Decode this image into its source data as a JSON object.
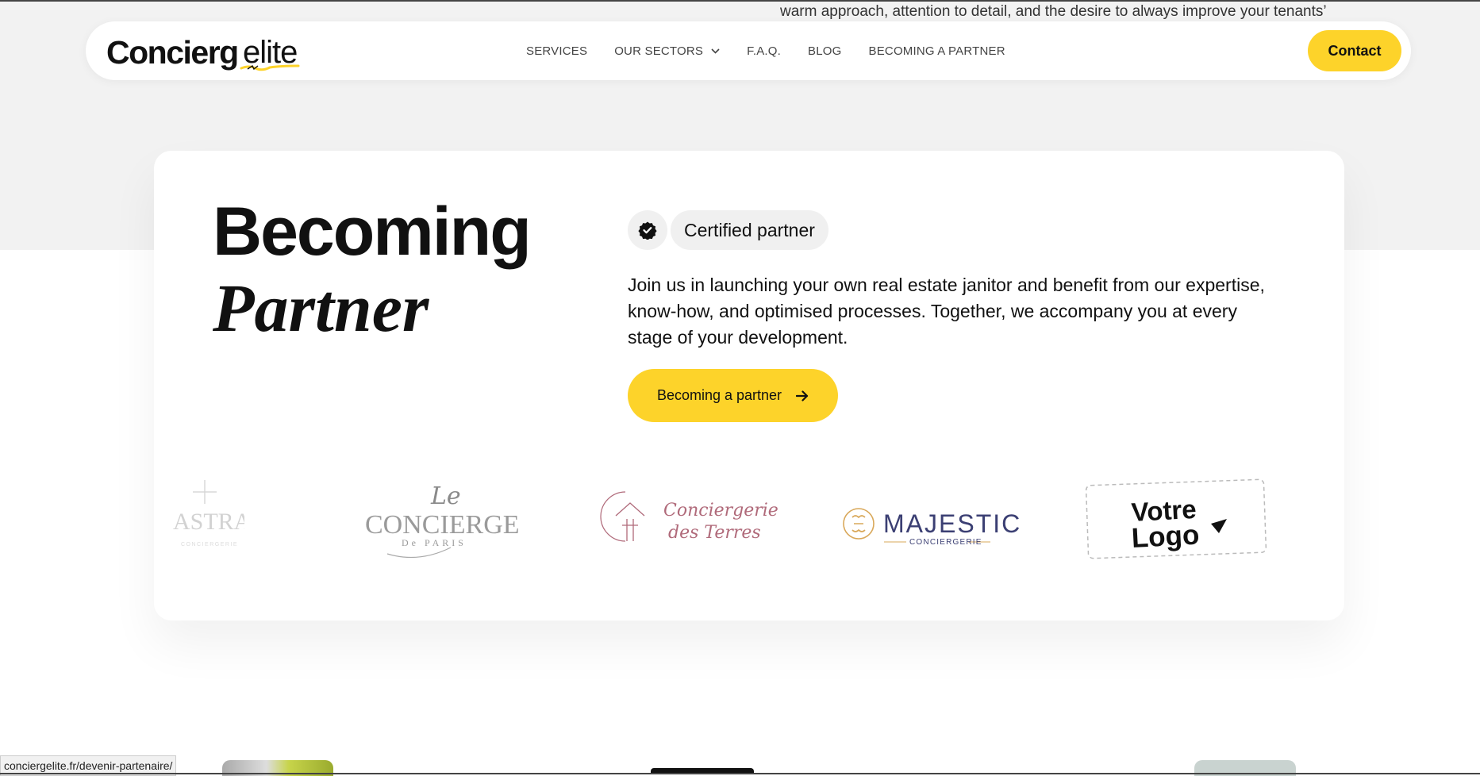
{
  "ticker_text": "warm approach, attention to detail, and the desire to always improve your tenants’",
  "brand": {
    "name_main": "Concierg",
    "name_elite": "elite"
  },
  "nav": {
    "items": [
      {
        "label": "SERVICES"
      },
      {
        "label": "OUR SECTORS",
        "has_dropdown": true
      },
      {
        "label": "F.A.Q."
      },
      {
        "label": "BLOG"
      },
      {
        "label": "BECOMING A PARTNER"
      }
    ],
    "contact_label": "Contact"
  },
  "hero": {
    "title_line1": "Becoming",
    "title_line2": "Partner",
    "badge_label": "Certified partner",
    "description": "Join us in launching your own real estate janitor and benefit from our expertise, know-how, and optimised processes. Together, we accompany you at every stage of your development.",
    "cta_label": "Becoming a partner"
  },
  "partner_logos": {
    "astral": {
      "text": "ASTRAL",
      "sub": "CONCIERGERIE"
    },
    "le_concierge": {
      "script": "Le",
      "main": "CONCIERGE",
      "sub": "De PARIS"
    },
    "terres": {
      "line1": "Conciergerie",
      "line2": "des Terres"
    },
    "majestic": {
      "main": "MAJESTIC",
      "sub": "CONCIERGERIE"
    },
    "votre_logo": {
      "line1": "Votre",
      "line2": "Logo"
    }
  },
  "status_bar_url": "conciergelite.fr/devenir-partenaire/",
  "colors": {
    "accent": "#fdd32a",
    "background_band": "#f2f2f2",
    "text": "#111111"
  },
  "icons": {
    "badge": "verified-badge-icon",
    "cta_arrow": "arrow-right-icon",
    "dropdown": "chevron-down-icon"
  }
}
